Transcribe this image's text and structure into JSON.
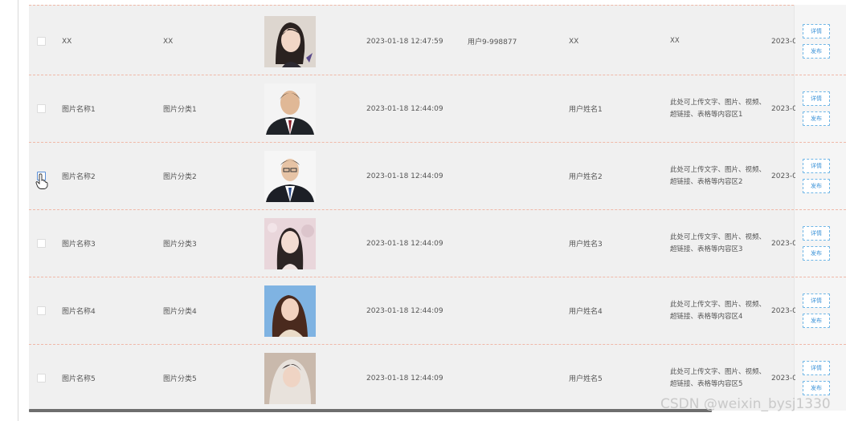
{
  "rows": [
    {
      "name": "XX",
      "category": "XX",
      "photo": "photo-woman-short-hair",
      "time": "2023-01-18 12:47:59",
      "user_id": "用户9-998877",
      "user_name": "XX",
      "desc": "XX",
      "date": "2023-0",
      "detail_label": "详情",
      "publish_label": "发布"
    },
    {
      "name": "图片名称1",
      "category": "图片分类1",
      "photo": "photo-man-suit",
      "time": "2023-01-18 12:44:09",
      "user_id": "",
      "user_name": "用户姓名1",
      "desc": "此处可上传文字、图片、视频、超链接、表格等内容区1",
      "date": "2023-0",
      "detail_label": "详情",
      "publish_label": "发布"
    },
    {
      "name": "图片名称2",
      "category": "图片分类2",
      "photo": "photo-young-man-glasses",
      "time": "2023-01-18 12:44:09",
      "user_id": "",
      "user_name": "用户姓名2",
      "desc": "此处可上传文字、图片、视频、超链接、表格等内容区2",
      "date": "2023-0",
      "detail_label": "详情",
      "publish_label": "发布"
    },
    {
      "name": "图片名称3",
      "category": "图片分类3",
      "photo": "photo-woman-pink",
      "time": "2023-01-18 12:44:09",
      "user_id": "",
      "user_name": "用户姓名3",
      "desc": "此处可上传文字、图片、视频、超链接、表格等内容区3",
      "date": "2023-0",
      "detail_label": "详情",
      "publish_label": "发布"
    },
    {
      "name": "图片名称4",
      "category": "图片分类4",
      "photo": "photo-woman-blue-sky",
      "time": "2023-01-18 12:44:09",
      "user_id": "",
      "user_name": "用户姓名4",
      "desc": "此处可上传文字、图片、视频、超链接、表格等内容区4",
      "date": "2023-0",
      "detail_label": "详情",
      "publish_label": "发布"
    },
    {
      "name": "图片名称5",
      "category": "图片分类5",
      "photo": "photo-woman-veil",
      "time": "2023-01-18 12:44:09",
      "user_id": "",
      "user_name": "用户姓名5",
      "desc": "此处可上传文字、图片、视频、超链接、表格等内容区5",
      "date": "2023-0",
      "detail_label": "详情",
      "publish_label": "发布"
    }
  ],
  "watermark": "CSDN @weixin_bysj1330",
  "colors": {
    "accent": "#3c93d8",
    "row_bg": "#f0f0f0",
    "divider": "#f0b8a8"
  },
  "cursor_icon": "hand-pointer-icon"
}
